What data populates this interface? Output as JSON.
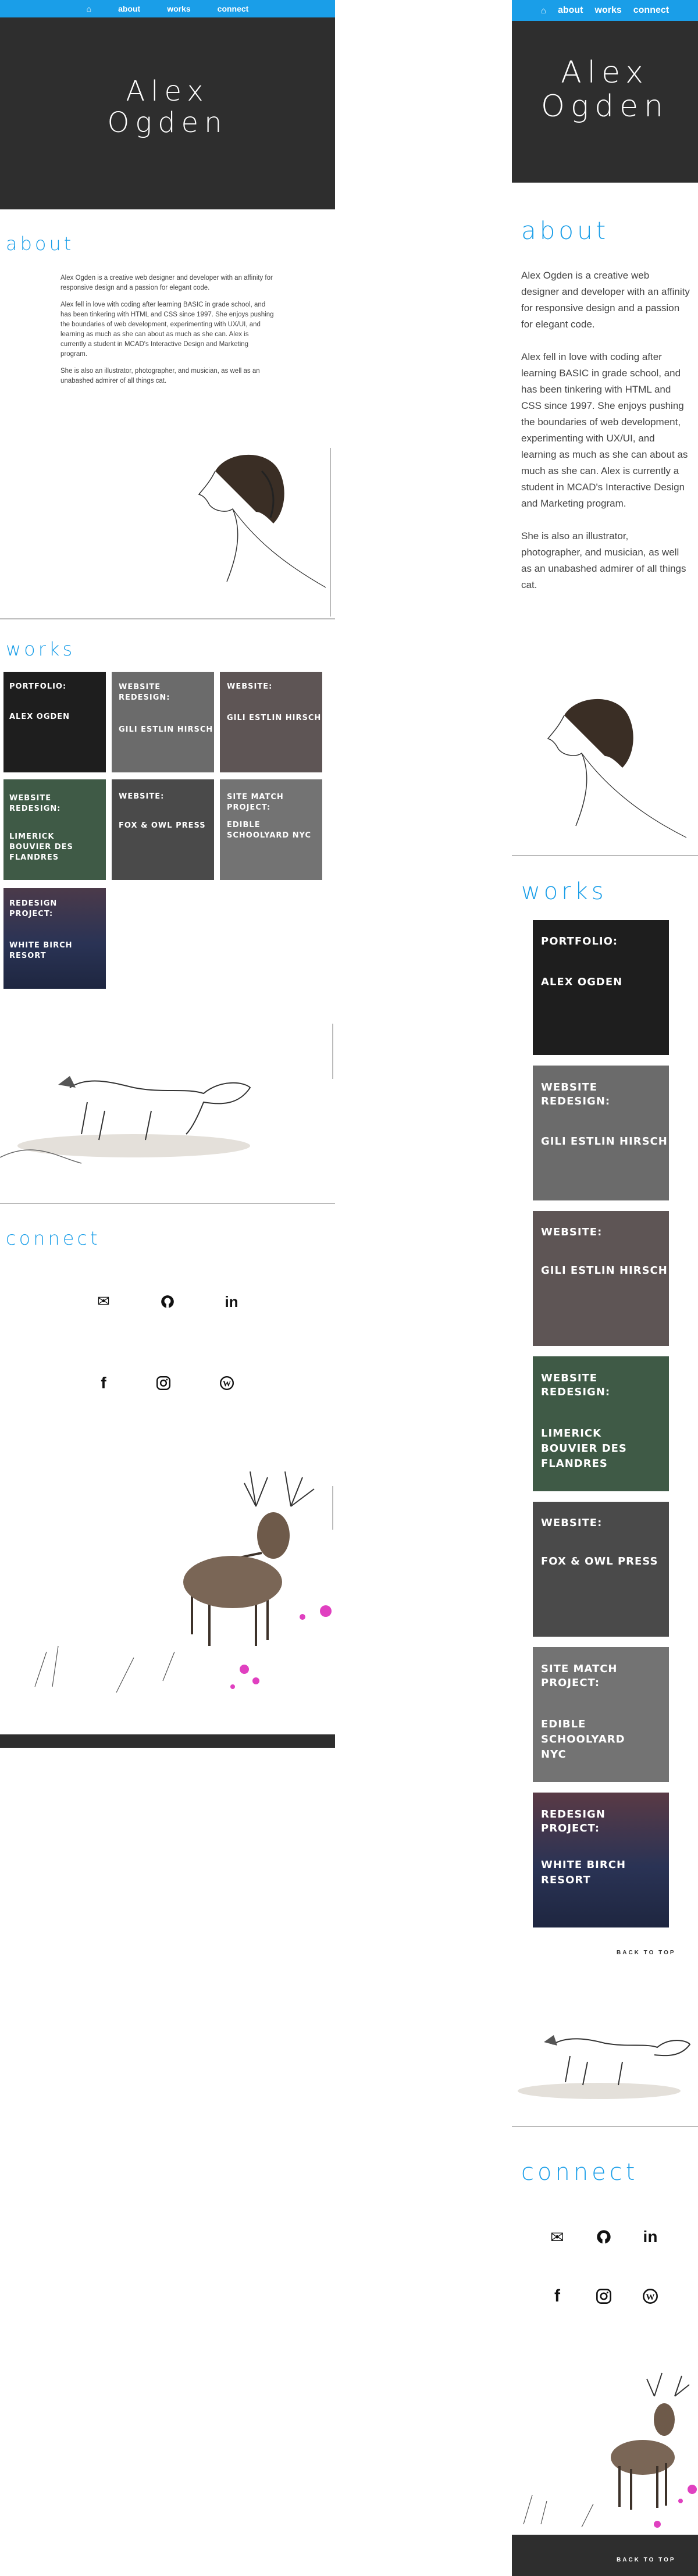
{
  "nav": {
    "home_icon": "home-icon",
    "items": [
      "about",
      "works",
      "connect"
    ]
  },
  "hero": {
    "line1": "Alex",
    "line2": "Ogden"
  },
  "about": {
    "title": "about",
    "p1": "Alex Ogden is a creative web designer and developer with an affinity for responsive design and a passion for elegant code.",
    "p2": "Alex fell in love with coding after learning BASIC in grade school, and has been tinkering with HTML and CSS since 1997. She enjoys pushing the boundaries of web development, experimenting with UX/UI, and learning as much as she can about as much as she can. Alex is currently a student in MCAD's Interactive Design and Marketing program.",
    "p3": "She is also an illustrator, photographer, and musician, as well as an unabashed admirer of all things cat."
  },
  "works": {
    "title": "works",
    "tiles": [
      {
        "label": "PORTFOLIO:",
        "name": "ALEX OGDEN",
        "bg": "#1e1e1e"
      },
      {
        "label": "WEBSITE REDESIGN:",
        "name": "GILI ESTLIN HIRSCH",
        "bg": "#6b6b6b"
      },
      {
        "label": "WEBSITE:",
        "name": "GILI ESTLIN HIRSCH",
        "bg": "#5e5555"
      },
      {
        "label": "WEBSITE REDESIGN:",
        "name": "LIMERICK BOUVIER DES FLANDRES",
        "bg": "#3f5a46"
      },
      {
        "label": "WEBSITE:",
        "name": "FOX & OWL PRESS",
        "bg": "#4a4a4a"
      },
      {
        "label": "SITE MATCH PROJECT:",
        "name": "EDIBLE SCHOOLYARD NYC",
        "bg": "#737373"
      },
      {
        "label": "REDESIGN PROJECT:",
        "name": "WHITE BIRCH RESORT",
        "bg": "#2a3355"
      }
    ],
    "back_to_top": "BACK TO TOP"
  },
  "connect": {
    "title": "connect",
    "icons": [
      "envelope-icon",
      "github-icon",
      "linkedin-icon",
      "facebook-icon",
      "instagram-icon",
      "wordpress-icon"
    ]
  },
  "footer": {
    "back_to_top": "BACK TO TOP"
  },
  "colors": {
    "accent": "#1a9ee8",
    "dark": "#2e2e2e"
  }
}
